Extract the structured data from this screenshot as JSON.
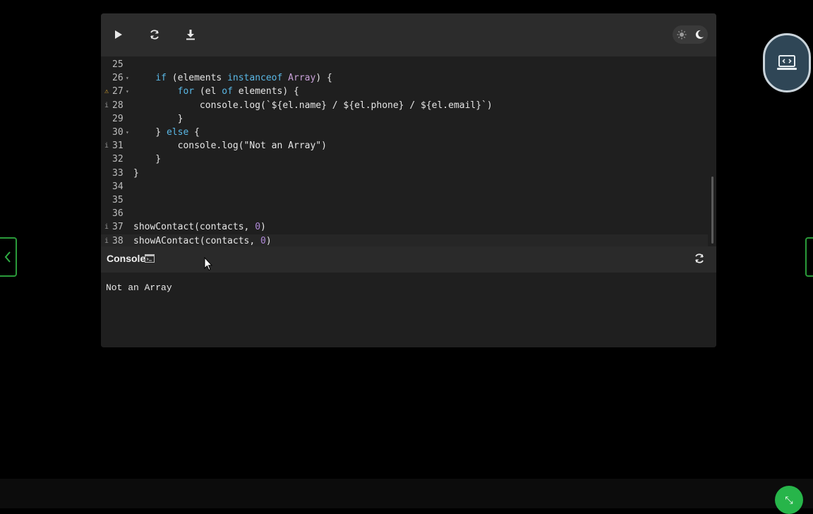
{
  "toolbar": {
    "run_icon": "play-icon",
    "reload_icon": "refresh-icon",
    "download_icon": "download-icon",
    "theme": {
      "light_icon": "sun-icon",
      "dark_icon": "moon-icon"
    }
  },
  "editor": {
    "lines": [
      {
        "num": "25",
        "mark": "",
        "fold": "",
        "code": ""
      },
      {
        "num": "26",
        "mark": "",
        "fold": "▾",
        "code": "    if (elements instanceof Array) {"
      },
      {
        "num": "27",
        "mark": "⚠",
        "fold": "▾",
        "code": "        for (el of elements) {"
      },
      {
        "num": "28",
        "mark": "i",
        "fold": "",
        "code": "            console.log(`${el.name} / ${el.phone} / ${el.email}`)"
      },
      {
        "num": "29",
        "mark": "",
        "fold": "",
        "code": "        }"
      },
      {
        "num": "30",
        "mark": "",
        "fold": "▾",
        "code": "    } else {"
      },
      {
        "num": "31",
        "mark": "i",
        "fold": "",
        "code": "        console.log(\"Not an Array\")"
      },
      {
        "num": "32",
        "mark": "",
        "fold": "",
        "code": "    }"
      },
      {
        "num": "33",
        "mark": "",
        "fold": "",
        "code": "}"
      },
      {
        "num": "34",
        "mark": "",
        "fold": "",
        "code": ""
      },
      {
        "num": "35",
        "mark": "",
        "fold": "",
        "code": ""
      },
      {
        "num": "36",
        "mark": "",
        "fold": "",
        "code": ""
      },
      {
        "num": "37",
        "mark": "i",
        "fold": "",
        "code": "showContact(contacts, 0)"
      },
      {
        "num": "38",
        "mark": "i",
        "fold": "",
        "code": "showAContact(contacts, 0)"
      }
    ]
  },
  "console": {
    "title": "Console",
    "output": "Not an Array"
  },
  "colors": {
    "accent_green": "#27b54a",
    "panel_bg": "#1f1f1f",
    "keyword": "#5ab8e6"
  }
}
